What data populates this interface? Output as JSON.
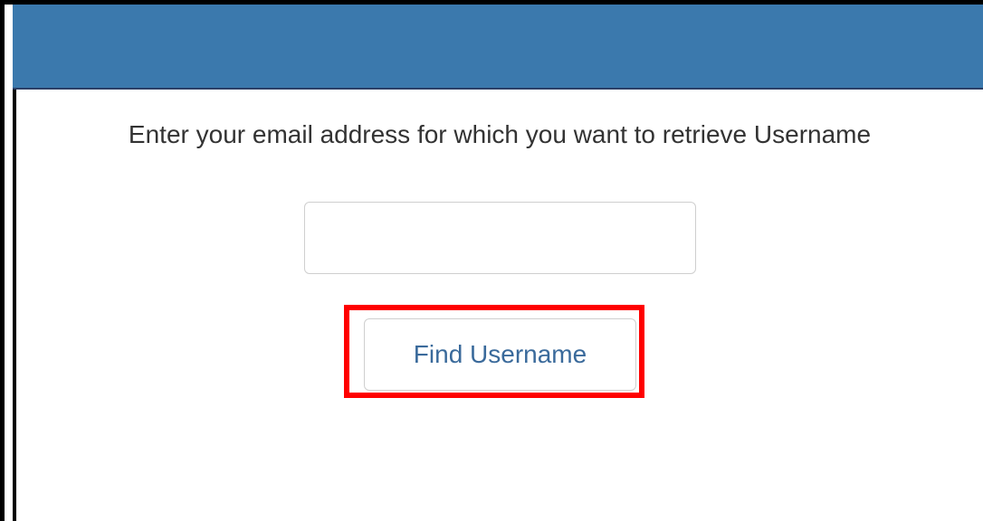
{
  "form": {
    "instruction": "Enter your email address for which you want to retrieve Username",
    "email_value": "",
    "email_placeholder": "",
    "submit_label": "Find Username"
  },
  "colors": {
    "header": "#3b79ad",
    "button_text": "#3a6a9b",
    "highlight": "#ff0000"
  }
}
